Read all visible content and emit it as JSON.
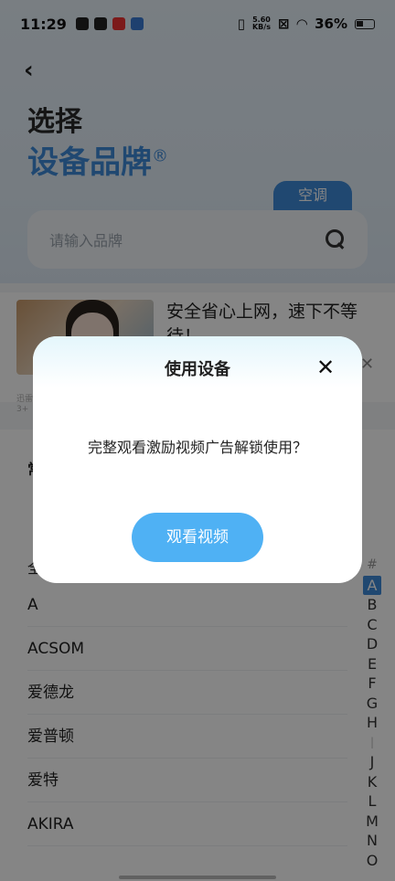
{
  "status_bar": {
    "time": "11:29",
    "speed_value": "5.60",
    "speed_unit": "KB/s",
    "battery": "36%"
  },
  "header": {
    "title_line1": "选择",
    "title_line2": "设备品牌",
    "registered_mark": "®"
  },
  "category_tab": "空调",
  "search": {
    "placeholder": "请输入品牌"
  },
  "ad": {
    "text": "安全省心上网，速下不等待！",
    "sub_line1": "迅雷",
    "sub_line2": "3+"
  },
  "list": {
    "section_heading_partial": "常",
    "all_label_partial": "全",
    "rows": [
      "A",
      "ACSOM",
      "爱德龙",
      "爱普顿",
      "爱特",
      "AKIRA"
    ]
  },
  "alphabet": {
    "hash": "#",
    "selected": "A",
    "letters": [
      "B",
      "C",
      "D",
      "E",
      "F",
      "G",
      "H"
    ],
    "separator": "|",
    "letters2": [
      "J",
      "K",
      "L",
      "M",
      "N",
      "O"
    ]
  },
  "dialog": {
    "title": "使用设备",
    "message": "完整观看激励视频广告解锁使用？",
    "button": "观看视频"
  },
  "colors": {
    "accent": "#3f8bd8",
    "button": "#4fb1f4"
  }
}
